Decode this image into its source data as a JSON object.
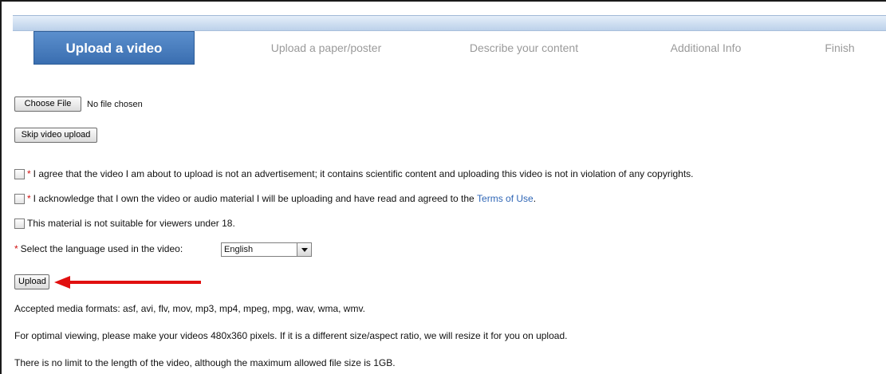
{
  "steps": [
    {
      "label": "Upload a video",
      "active": true
    },
    {
      "label": "Upload a paper/poster",
      "active": false
    },
    {
      "label": "Describe your content",
      "active": false
    },
    {
      "label": "Additional Info",
      "active": false
    },
    {
      "label": "Finish",
      "active": false
    }
  ],
  "file": {
    "choose_label": "Choose File",
    "status": "No file chosen"
  },
  "skip_label": "Skip video upload",
  "checkboxes": [
    {
      "required": true,
      "text": "I agree that the video I am about to upload is not an advertisement; it contains scientific content and uploading this video is not in violation of any copyrights."
    },
    {
      "required": true,
      "text_before": "I acknowledge that I own the video or audio material I will be uploading and have read and agreed to the ",
      "link": "Terms of Use",
      "text_after": "."
    },
    {
      "required": false,
      "text": "This material is not suitable for viewers under 18."
    }
  ],
  "required_mark": "*",
  "language": {
    "label": "Select the language used in the video:",
    "selected": "English"
  },
  "upload_label": "Upload",
  "info": [
    "Accepted media formats: asf, avi, flv, mov, mp3, mp4, mpeg, mpg, wav, wma, wmv.",
    "For optimal viewing, please make your videos 480x360 pixels. If it is a different size/aspect ratio, we will resize it for you on upload.",
    "There is no limit to the length of the video, although the maximum allowed file size is 1GB."
  ],
  "colors": {
    "active_step": "#4a7fc0",
    "required": "#d01010",
    "link": "#2f66b6",
    "annotation_arrow": "#e11010"
  },
  "icons": {
    "select_arrow": "chevron-down-icon",
    "annotation": "arrow-left-icon"
  }
}
